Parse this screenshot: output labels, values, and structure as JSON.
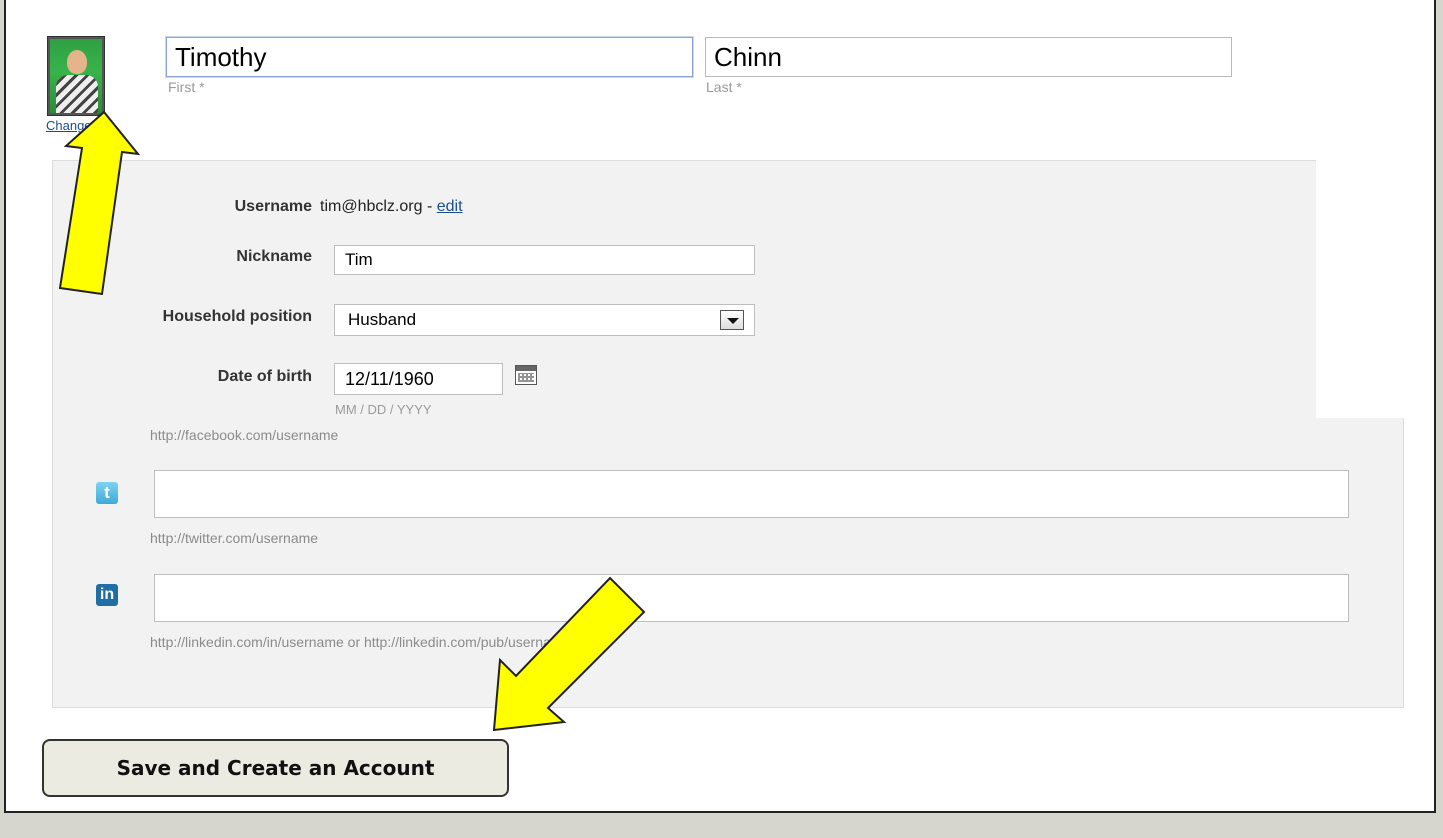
{
  "profile": {
    "change_label": "Change",
    "first_name": "Timothy",
    "last_name": "Chinn",
    "first_label": "First *",
    "last_label": "Last *"
  },
  "details": {
    "username_label": "Username",
    "username_value": "tim@hbclz.org - ",
    "username_edit": "edit",
    "nickname_label": "Nickname",
    "nickname_value": "Tim",
    "household_label": "Household position",
    "household_value": "Husband",
    "dob_label": "Date of birth",
    "dob_value": "12/11/1960",
    "dob_hint": "MM / DD / YYYY"
  },
  "social": {
    "facebook_hint": "http://facebook.com/username",
    "twitter_hint": "http://twitter.com/username",
    "linkedin_hint": "http://linkedin.com/in/username   or   http://linkedin.com/pub/username",
    "twitter_icon": "t",
    "linkedin_icon": "in"
  },
  "actions": {
    "save_label": "Save and Create an Account"
  },
  "colors": {
    "annotation_arrow": "#ffff00",
    "link": "#1a4f8f"
  }
}
